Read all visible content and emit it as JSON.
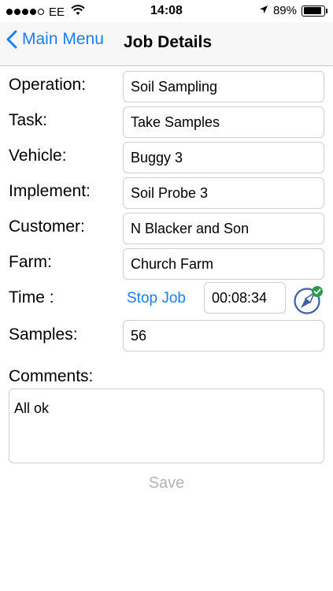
{
  "status_bar": {
    "carrier": "EE",
    "time": "14:08",
    "battery": "89%",
    "battery_level": 0.89
  },
  "nav": {
    "back_label": "Main Menu",
    "title": "Job Details"
  },
  "form": {
    "fields": [
      {
        "label": "Operation:",
        "value": "Soil Sampling"
      },
      {
        "label": "Task:",
        "value": "Take Samples"
      },
      {
        "label": "Vehicle:",
        "value": "Buggy 3"
      },
      {
        "label": "Implement:",
        "value": "Soil Probe 3"
      },
      {
        "label": "Customer:",
        "value": "N Blacker and Son"
      },
      {
        "label": "Farm:",
        "value": "Church Farm"
      }
    ],
    "time_label": "Time :",
    "stop_job_label": "Stop Job",
    "timer_value": "00:08:34",
    "samples_label": "Samples:",
    "samples_value": "56",
    "comments_label": "Comments:",
    "comments_value": "All ok",
    "save_label": "Save"
  },
  "icons": {
    "back": "chevron-left-icon",
    "wifi": "wifi-icon",
    "location": "location-arrow-icon",
    "compass": "compass-icon",
    "check": "checkmark-badge-icon"
  },
  "colors": {
    "accent": "#1a7ff3",
    "compass_ring": "#3e5fa6",
    "check_badge": "#2e9b4a",
    "disabled": "#b3b3b5"
  }
}
